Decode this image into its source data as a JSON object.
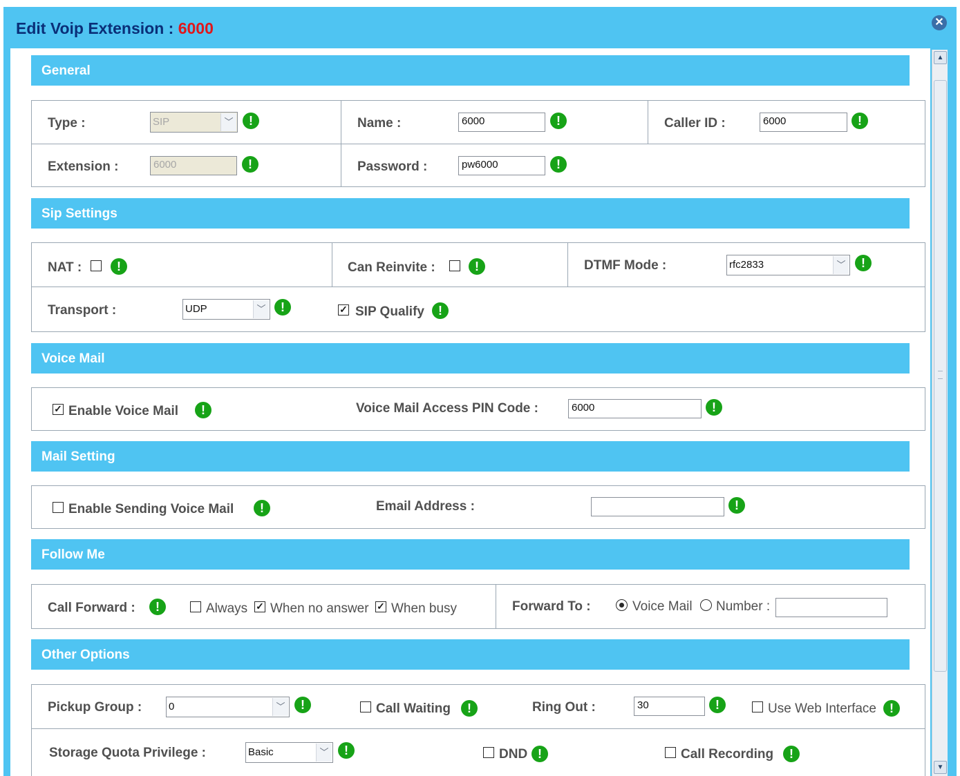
{
  "dialog": {
    "title": "Edit Voip Extension : ",
    "extension_number": "6000"
  },
  "sections": {
    "general": "General",
    "sip": "Sip Settings",
    "voicemail": "Voice Mail",
    "mail": "Mail Setting",
    "followme": "Follow Me",
    "other": "Other Options"
  },
  "general": {
    "type_label": "Type :",
    "type_value": "SIP",
    "name_label": "Name :",
    "name_value": "6000",
    "callerid_label": "Caller ID :",
    "callerid_value": "6000",
    "extension_label": "Extension :",
    "extension_value": "6000",
    "password_label": "Password :",
    "password_value": "pw6000"
  },
  "sip": {
    "nat_label": "NAT :",
    "nat_checked": false,
    "reinvite_label": "Can Reinvite :",
    "reinvite_checked": false,
    "dtmf_label": "DTMF Mode :",
    "dtmf_value": "rfc2833",
    "transport_label": "Transport :",
    "transport_value": "UDP",
    "qualify_label": "SIP Qualify",
    "qualify_checked": true
  },
  "voicemail": {
    "enable_label": "Enable Voice Mail",
    "enable_checked": true,
    "pin_label": "Voice Mail Access PIN Code :",
    "pin_value": "6000"
  },
  "mail": {
    "sending_label": "Enable Sending Voice Mail",
    "sending_checked": false,
    "email_label": "Email Address :",
    "email_value": ""
  },
  "followme": {
    "callforward_label": "Call Forward :",
    "always_label": "Always",
    "always_checked": false,
    "noanswer_label": "When no answer",
    "noanswer_checked": true,
    "busy_label": "When busy",
    "busy_checked": true,
    "forwardto_label": "Forward To :",
    "voicemail_option": "Voice Mail",
    "voicemail_selected": true,
    "number_option": "Number :",
    "number_value": ""
  },
  "other": {
    "pickup_label": "Pickup Group :",
    "pickup_value": "0",
    "callwaiting_label": "Call Waiting",
    "callwaiting_checked": false,
    "ringout_label": "Ring Out :",
    "ringout_value": "30",
    "webinterface_label": "Use Web Interface",
    "webinterface_checked": false,
    "quota_label": "Storage Quota Privilege :",
    "quota_value": "Basic",
    "dnd_label": "DND",
    "dnd_checked": false,
    "recording_label": "Call Recording",
    "recording_checked": false
  },
  "icons": {
    "info": "info-exclamation-icon",
    "close": "close-icon",
    "check": "✓"
  },
  "colors": {
    "header": "#4fc4f2",
    "title": "#0a2f78",
    "title_number": "#e0171b",
    "info_icon": "#17a317"
  }
}
